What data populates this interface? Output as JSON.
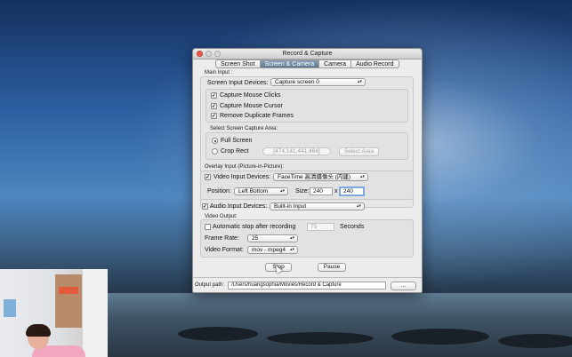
{
  "window": {
    "title": "Record & Capture"
  },
  "tabs": [
    "Screen Shot",
    "Screen & Camera",
    "Camera",
    "Audio Record"
  ],
  "main_input": {
    "section_label": "Main Input :",
    "devices_label": "Screen Input Devices:",
    "devices_value": "Capture screen 0",
    "options": [
      {
        "label": "Capture Mouse Clicks",
        "checked": true
      },
      {
        "label": "Capture Mouse Cursor",
        "checked": true
      },
      {
        "label": "Remove Duplicate Frames",
        "checked": true
      }
    ]
  },
  "capture_area": {
    "section_label": "Select Screen Capture Area:",
    "full_screen": "Full Screen",
    "crop_rect": "Crop Rect",
    "crop_value": "[474,141,441,464]",
    "select_area_button": "Select Area"
  },
  "overlay": {
    "section_label": "Overlay Input (Picture-in-Picture):",
    "video_devices_label": "Video Input Devices:",
    "video_devices_value": "FaceTime 高清摄像头 (内建)",
    "position_label": "Position:",
    "position_value": "Left Bottom",
    "size_label": "Size:",
    "size_width": "240",
    "size_separator": "x",
    "size_height": "240"
  },
  "audio": {
    "label": "Audio Input Devices:",
    "value": "Built-in Input"
  },
  "video_output": {
    "section_label": "Video Output:",
    "auto_stop_label": "Automatic stop after recording",
    "auto_stop_value": "75",
    "seconds_label": "Seconds",
    "frame_rate_label": "Frame Rate:",
    "frame_rate_value": "25",
    "format_label": "Video Format:",
    "format_value": "mov - mpeg4"
  },
  "buttons": {
    "stop": "Stop",
    "pause": "Pause",
    "browse": "..."
  },
  "output": {
    "label": "Output path:",
    "path": "/Users/huangsophia/Movies/Record & Capture"
  },
  "colors": {
    "close": "#f25a4d",
    "active_tab": "#6d8499",
    "focus_ring": "#7fa9de"
  }
}
